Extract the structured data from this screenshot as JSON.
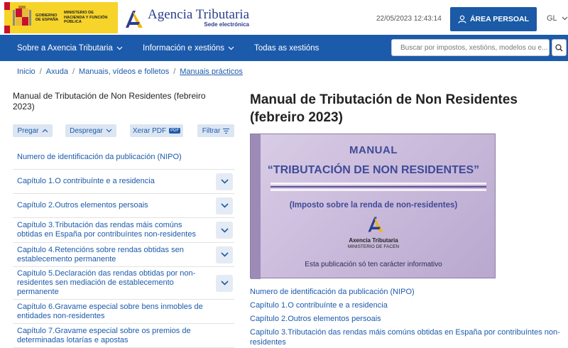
{
  "header": {
    "gov_text_a": "GOBIERNO DE ESPAÑA",
    "gov_text_b": "MINISTERIO DE HACIENDA Y FUNCIÓN PÚBLICA",
    "brand_name": "Agencia Tributaria",
    "brand_sub": "Sede electrónica",
    "datetime": "22/05/2023 12:43:14",
    "personal_area_label": "ÁREA PERSOAL",
    "language": "GL"
  },
  "nav": {
    "items": [
      {
        "label": "Sobre a Axencia Tributaria"
      },
      {
        "label": "Información e xestións"
      },
      {
        "label": "Todas as xestións"
      }
    ],
    "search_placeholder": "Buscar por impostos, xestións, modelos ou e..."
  },
  "breadcrumb": [
    "Inicio",
    "Axuda",
    "Manuais, vídeos e folletos",
    "Manuais prácticos"
  ],
  "sidebar": {
    "title": "Manual de Tributación de Non Residentes (febreiro 2023)",
    "toolbar": {
      "collapse": "Pregar",
      "expand": "Despregar",
      "pdf": "Xerar PDF",
      "pdf_badge": "PDF",
      "filter": "Filtrar"
    },
    "items": [
      {
        "label": "Numero de identificación da publicación (NIPO)"
      },
      {
        "label": "Capítulo 1.O contribuínte e a residencia"
      },
      {
        "label": "Capítulo 2.Outros elementos persoais"
      },
      {
        "label": "Capítulo 3.Tributación das rendas máis comúns obtidas en España por contribuíntes non-residentes"
      },
      {
        "label": "Capítulo 4.Retencións sobre rendas obtidas sen establecemento permanente"
      },
      {
        "label": "Capítulo 5.Declaración das rendas obtidas por non-residentes sen mediación de establecemento permanente"
      },
      {
        "label": "Capítulo 6.Gravame especial sobre bens inmobles de entidades non-residentes"
      },
      {
        "label": "Capítulo 7.Gravame especial sobre os premios de determinadas lotarías e apostas"
      }
    ]
  },
  "main": {
    "title": "Manual de Tributación de Non Residentes (febreiro 2023)",
    "cover": {
      "heading": "MANUAL",
      "subheading": "“TRIBUTACIÓN DE NON RESIDENTES”",
      "subtitle": "(Imposto sobre la renda de non-residentes)",
      "org": "Axencia Tributaria",
      "ministry": "MINISTERIO DE FACEN",
      "note": "Esta publicación só ten carácter informativo"
    },
    "links": [
      {
        "label": "Numero de identificación da publicación (NIPO)"
      },
      {
        "label": "Capítulo 1.O contribuínte e a residencia"
      },
      {
        "label": "Capítulo 2.Outros elementos persoais"
      },
      {
        "label": "Capítulo 3.Tributación das rendas máis comúns obtidas en España por contribuíntes non-residentes"
      }
    ]
  },
  "colors": {
    "primary": "#1c5aab",
    "personal_button": "#1a5aa6",
    "gov_yellow": "#f6d42a",
    "cover_purple": "#cbbcdc"
  }
}
